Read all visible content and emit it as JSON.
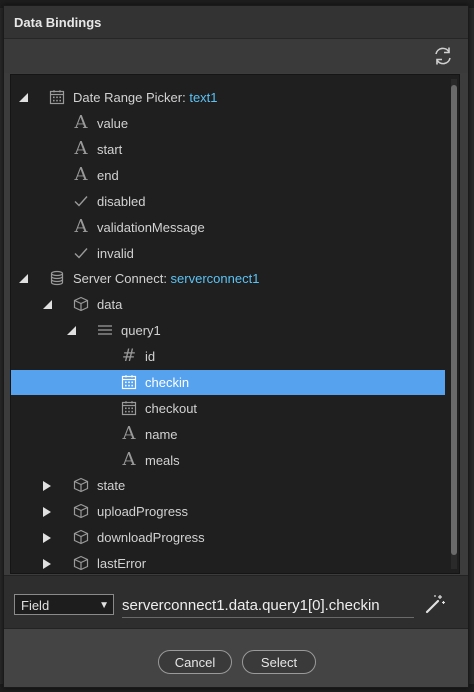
{
  "dialog": {
    "title": "Data Bindings"
  },
  "tree": {
    "date_picker": {
      "label": "Date Range Picker: ",
      "highlight": "text1"
    },
    "dp_value": "value",
    "dp_start": "start",
    "dp_end": "end",
    "dp_disabled": "disabled",
    "dp_validation": "validationMessage",
    "dp_invalid": "invalid",
    "server_connect": {
      "label": "Server Connect: ",
      "highlight": "serverconnect1"
    },
    "data": "data",
    "query1": "query1",
    "id": "id",
    "checkin": "checkin",
    "checkout": "checkout",
    "name": "name",
    "meals": "meals",
    "state": "state",
    "upload": "uploadProgress",
    "download": "downloadProgress",
    "last_error": "lastError"
  },
  "expression": {
    "type": "Field",
    "value": "serverconnect1.data.query1[0].checkin"
  },
  "footer": {
    "cancel": "Cancel",
    "select": "Select"
  },
  "colors": {
    "selection": "#56a2ee",
    "highlight": "#5cc3f5"
  }
}
